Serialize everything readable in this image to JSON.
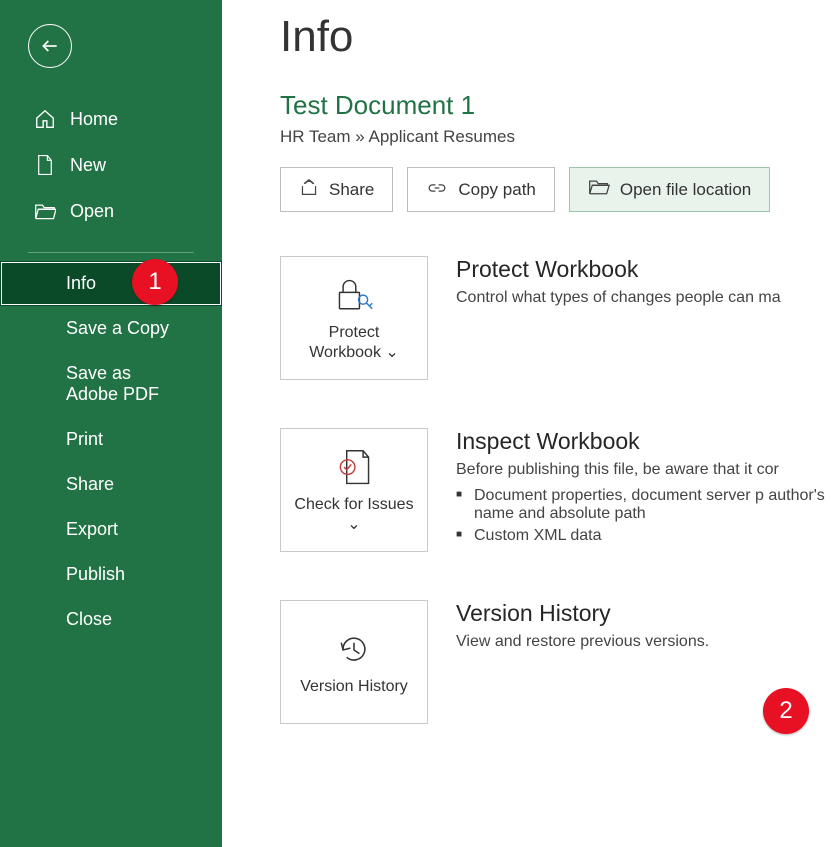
{
  "sidebar": {
    "items": [
      {
        "label": "Home"
      },
      {
        "label": "New"
      },
      {
        "label": "Open"
      },
      {
        "label": "Info"
      },
      {
        "label": "Save a Copy"
      },
      {
        "label": "Save as Adobe PDF"
      },
      {
        "label": "Print"
      },
      {
        "label": "Share"
      },
      {
        "label": "Export"
      },
      {
        "label": "Publish"
      },
      {
        "label": "Close"
      }
    ]
  },
  "page": {
    "title": "Info",
    "docTitle": "Test Document 1",
    "breadcrumb": "HR Team » Applicant Resumes"
  },
  "actions": {
    "share": "Share",
    "copyPath": "Copy path",
    "openLocation": "Open file location"
  },
  "sections": {
    "protect": {
      "tile": "Protect Workbook ⌄",
      "title": "Protect Workbook",
      "desc": "Control what types of changes people can ma"
    },
    "inspect": {
      "tile": "Check for Issues ⌄",
      "title": "Inspect Workbook",
      "desc": "Before publishing this file, be aware that it cor",
      "bullets": [
        "Document properties, document server p author's name and absolute path",
        "Custom XML data"
      ]
    },
    "history": {
      "tile": "Version History",
      "title": "Version History",
      "desc": "View and restore previous versions."
    }
  },
  "callouts": {
    "one": "1",
    "two": "2"
  }
}
